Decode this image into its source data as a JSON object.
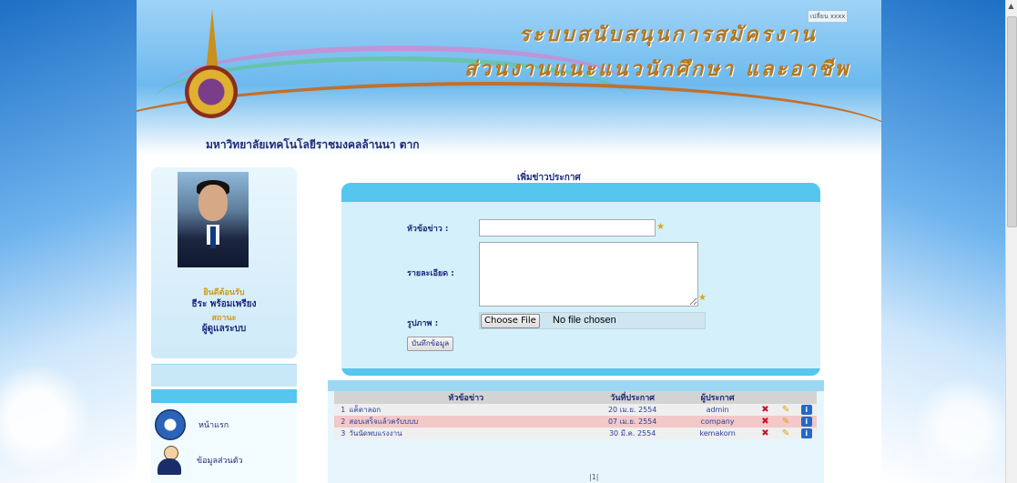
{
  "header": {
    "tiny_button": "เปลี่ยน xxxx",
    "title_line1": "ระบบสนับสนุนการสมัครงาน",
    "title_line2": "ส่วนงานแนะแนวนักศึกษา และอาชีพ",
    "university": "มหาวิทยาลัยเทคโนโลยีราชมงคลล้านนา ตาก"
  },
  "profile": {
    "welcome": "ยินดีต้อนรับ",
    "name": "ธีระ พร้อมเพรียง",
    "status_label": "สถานะ",
    "role": "ผู้ดูแลระบบ"
  },
  "menu": {
    "items": [
      {
        "label": "หน้าแรก",
        "icon": "home-icon"
      },
      {
        "label": "ข้อมูลส่วนตัว",
        "icon": "user-icon"
      }
    ]
  },
  "form": {
    "heading": "เพิ่มข่าวประกาศ",
    "subject_label": "หัวข้อข่าว :",
    "subject_value": "",
    "detail_label": "รายละเอียด :",
    "detail_value": "",
    "image_label": "รูปภาพ :",
    "choose_file": "Choose File",
    "no_file": "No file chosen",
    "save_button": "บันทึกข้อมูล",
    "required_mark": "★"
  },
  "table": {
    "headers": [
      "หัวข้อข่าว",
      "วันที่ประกาศ",
      "ผู้ประกาศ"
    ],
    "rows": [
      {
        "no": "1",
        "subject": "แค็ตาลอก",
        "date": "20 เม.ย. 2554",
        "author": "admin"
      },
      {
        "no": "2",
        "subject": "สอบเสร็จแล้วครับบบบ",
        "date": "07 เม.ย. 2554",
        "author": "company"
      },
      {
        "no": "3",
        "subject": "วันนัดพบแรงงาน",
        "date": "30 มี.ค. 2554",
        "author": "kemakorn"
      }
    ],
    "pager": "|1|",
    "actions": {
      "delete": "✖",
      "edit": "✎",
      "info": "i"
    }
  }
}
